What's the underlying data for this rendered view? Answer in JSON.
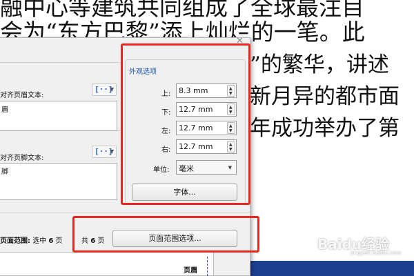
{
  "document": {
    "line1": "融中心等建筑共同组成了全球最注目",
    "line2": "会为“东方巴黎”添上灿烂的一笔。此",
    "line3": "”的繁华，讲述",
    "line4": "新月异的都市面",
    "line5": "年成功举办了第"
  },
  "dialog": {
    "close_glyph": "✕",
    "header_section": {
      "label": "对齐页眉文本:",
      "text": "眉",
      "insert_glyph": "[··]",
      "caret": "▼"
    },
    "footer_section": {
      "label": "对齐页脚文本:",
      "text": "脚",
      "insert_glyph": "[··]",
      "caret": "▼"
    },
    "appearance": {
      "title": "外观选项",
      "top_label": "上:",
      "top_value": "8.3 mm",
      "bottom_label": "下:",
      "bottom_value": "12.7 mm",
      "left_label": "左:",
      "left_value": "12.7 mm",
      "right_label": "右:",
      "right_value": "12.7 mm",
      "unit_label": "单位:",
      "unit_value": "毫米",
      "font_button": "字体..."
    },
    "page_range": {
      "label": "页面范围:",
      "selected_prefix": "选中",
      "selected_count": "6",
      "selected_suffix": "页",
      "total_prefix": "共",
      "total_count": "6",
      "total_suffix": "页",
      "options_button": "页面范围选项..."
    },
    "preview": {
      "label": "页眉"
    }
  },
  "watermark": {
    "text": "Baidu经验",
    "sub": "jingyan.baidu.com"
  },
  "colors": {
    "highlight": "#e8271f",
    "accent": "#2a62c9",
    "taskbar": "#1c3f8f"
  }
}
